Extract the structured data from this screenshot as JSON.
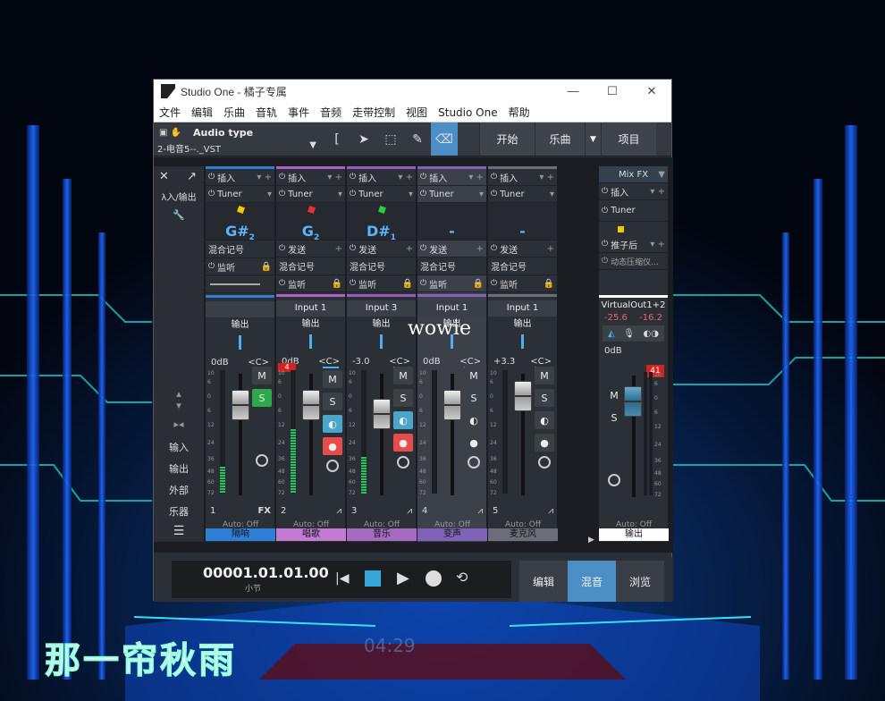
{
  "window": {
    "title": "Studio One - 橘子专属",
    "controls": [
      "—",
      "☐",
      "✕"
    ]
  },
  "menu": [
    "文件",
    "编辑",
    "乐曲",
    "音轨",
    "事件",
    "音频",
    "走带控制",
    "视图",
    "Studio One",
    "帮助"
  ],
  "toolbar": {
    "type_label": "Audio type",
    "preset": "2-电音5--._VST",
    "nav": [
      "开始",
      "乐曲",
      "项目"
    ]
  },
  "left_panel": {
    "top_label": "λ入/输出",
    "items": [
      "输入",
      "输出",
      "外部",
      "乐器"
    ]
  },
  "strips": [
    {
      "insert": "插入",
      "tuner": "Tuner",
      "note": "G#",
      "sub": "2",
      "dot": "#f0c800",
      "send": "混合记号",
      "listen": "监听",
      "input": "",
      "output": "输出",
      "gain": "0dB",
      "pan": "<C>",
      "num": "1",
      "tag": "FX",
      "auto": "Auto: Off",
      "name": "隔响",
      "name_bg": "#2e7fd6",
      "bar": "#2e7fd6",
      "meter_level": 0.22,
      "fader_pos": 0.18,
      "solo_on": true,
      "clip": ""
    },
    {
      "insert": "插入",
      "tuner": "Tuner",
      "note": "G",
      "sub": "2",
      "dot": "#e83030",
      "send": "发送",
      "mix": "混合记号",
      "listen": "监听",
      "input": "Input 1",
      "output": "输出",
      "gain": "0dB",
      "pan": "<C>",
      "num": "2",
      "auto": "Auto: Off",
      "name": "唱歌",
      "name_bg": "#c37bd6",
      "bar": "#b060c8",
      "meter_level": 0.52,
      "fader_pos": 0.18,
      "solo_on": false,
      "clip": "4"
    },
    {
      "insert": "插入",
      "tuner": "Tuner",
      "note": "D#",
      "sub": "1",
      "dot": "#22d040",
      "send": "发送",
      "mix": "混合记号",
      "listen": "监听",
      "input": "Input 3",
      "output": "输出",
      "gain": "-3.0",
      "pan": "<C>",
      "num": "3",
      "auto": "Auto: Off",
      "name": "音乐",
      "name_bg": "#a76ac2",
      "bar": "#9b5bbd",
      "meter_level": 0.3,
      "fader_pos": 0.28,
      "solo_on": false,
      "clip": ""
    },
    {
      "insert": "插入",
      "tuner": "Tuner",
      "note": "-",
      "sub": "",
      "dot": "",
      "send": "发送",
      "mix": "混合记号",
      "listen": "监听",
      "input": "Input 1",
      "output": "输出",
      "gain": "0dB",
      "pan": "<C>",
      "num": "4",
      "auto": "Auto: Off",
      "name": "变声",
      "name_bg": "#7f63b8",
      "bar": "#7f63b8",
      "meter_level": 0.0,
      "fader_pos": 0.18,
      "solo_on": false,
      "clip": ""
    },
    {
      "insert": "插入",
      "tuner": "Tuner",
      "note": "-",
      "sub": "",
      "dot": "",
      "send": "发送",
      "mix": "混合记号",
      "listen": "监听",
      "input": "Input 1",
      "output": "输出",
      "gain": "+3.3",
      "pan": "<C>",
      "num": "5",
      "auto": "Auto: Off",
      "name": "麦克风",
      "name_bg": "#6c6f7a",
      "bar": "#6c6f7a",
      "meter_level": 0.0,
      "fader_pos": 0.08,
      "solo_on": false,
      "clip": ""
    }
  ],
  "master": {
    "header": "Mix FX",
    "insert": "插入",
    "tuner": "Tuner",
    "post": "推子后",
    "plugin": "动态压缩仪...",
    "name": "VirtualOut1+2",
    "peak_l": "-25.6",
    "peak_r": "-16.2",
    "gain": "0dB",
    "clip": "41",
    "auto": "Auto: Off",
    "out_label": "输出"
  },
  "scale_labels": [
    "10",
    "6",
    "0",
    "6",
    "12",
    "24",
    "36",
    "48",
    "60",
    "72"
  ],
  "transport": {
    "time": "00001.01.01.00",
    "unit": "小节",
    "buttons": [
      "编辑",
      "混音",
      "浏览"
    ]
  },
  "overlay": {
    "watermark": "wowie",
    "caption": "那一帘秋雨",
    "clock": "04:29"
  }
}
